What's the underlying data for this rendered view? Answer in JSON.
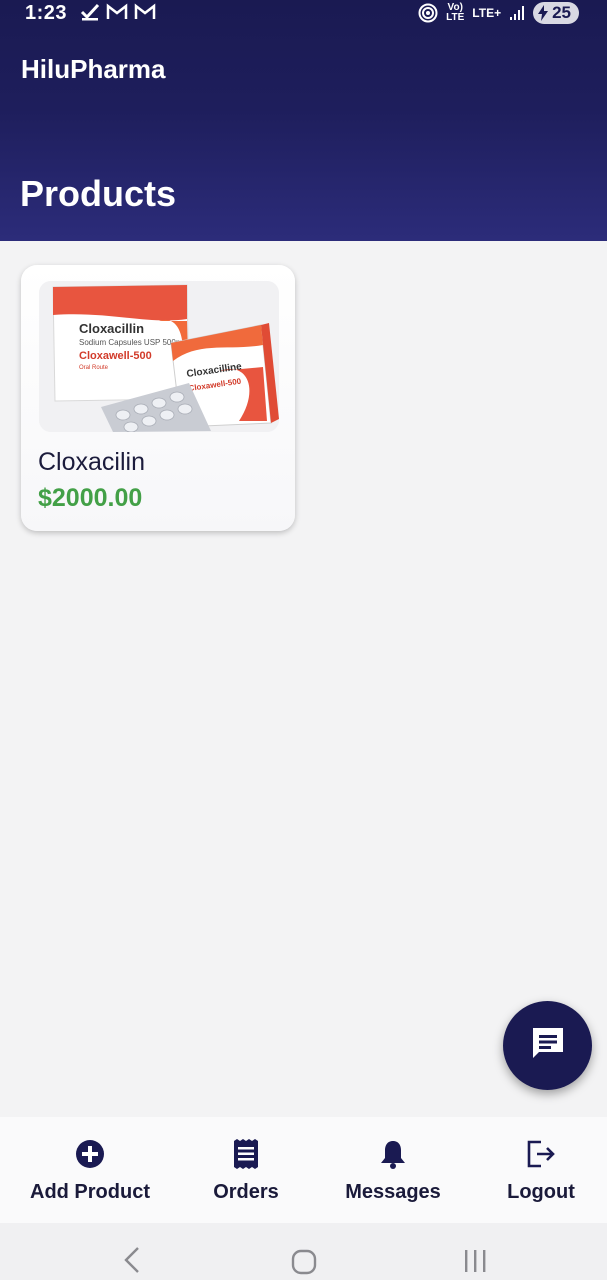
{
  "status_bar": {
    "time": "1:23",
    "notification_icons": [
      "check-icon",
      "gmail-icon",
      "gmail-icon"
    ],
    "network_lte_label_top": "Vo)",
    "network_lte_label_bottom": "LTE",
    "lte_plus_label": "LTE+",
    "battery_level": "25"
  },
  "app": {
    "title": "HiluPharma",
    "page_title": "Products",
    "colors": {
      "primary": "#1a1a52",
      "price": "#43a047",
      "background": "#f3f3f4"
    }
  },
  "products": [
    {
      "name": "Cloxacilin",
      "price": "$2000.00",
      "image": {
        "brand": "Cloxawell-500",
        "drug": "Cloxacillin",
        "subtitle": "Sodium Capsules USP 500mg",
        "route": "Oral Route"
      }
    }
  ],
  "fab": {
    "icon": "chat-icon"
  },
  "bottom_nav": [
    {
      "label": "Add Product",
      "icon": "add-circle-icon"
    },
    {
      "label": "Orders",
      "icon": "receipt-icon"
    },
    {
      "label": "Messages",
      "icon": "bell-icon"
    },
    {
      "label": "Logout",
      "icon": "logout-icon"
    }
  ],
  "system_nav": [
    "back-icon",
    "home-icon",
    "recents-icon"
  ]
}
